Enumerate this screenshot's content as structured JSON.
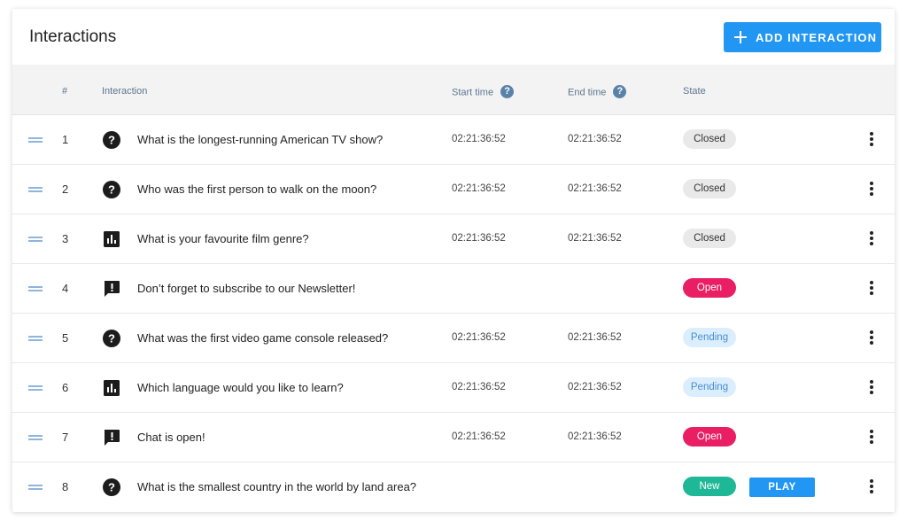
{
  "header": {
    "title": "Interactions",
    "add_button_label": "ADD INTERACTION"
  },
  "columns": {
    "num": "#",
    "interaction": "Interaction",
    "start_time": "Start time",
    "end_time": "End time",
    "state": "State",
    "help_glyph": "?"
  },
  "colors": {
    "accent": "#2196f3",
    "open": "#e91e63",
    "new": "#1fb896",
    "pending_bg": "#dbeefd"
  },
  "rows": [
    {
      "num": "1",
      "icon": "question-icon",
      "text": "What is the longest-running American TV show?",
      "start": "02:21:36:52",
      "end": "02:21:36:52",
      "state": "Closed",
      "state_kind": "closed"
    },
    {
      "num": "2",
      "icon": "question-icon",
      "text": "Who was the first person to walk on the moon?",
      "start": "02:21:36:52",
      "end": "02:21:36:52",
      "state": "Closed",
      "state_kind": "closed"
    },
    {
      "num": "3",
      "icon": "poll-icon",
      "text": "What is your favourite film genre?",
      "start": "02:21:36:52",
      "end": "02:21:36:52",
      "state": "Closed",
      "state_kind": "closed"
    },
    {
      "num": "4",
      "icon": "announcement-icon",
      "text": "Don’t forget to subscribe to our Newsletter!",
      "start": "",
      "end": "",
      "state": "Open",
      "state_kind": "open"
    },
    {
      "num": "5",
      "icon": "question-icon",
      "text": "What was the first video game console released?",
      "start": "02:21:36:52",
      "end": "02:21:36:52",
      "state": "Pending",
      "state_kind": "pending"
    },
    {
      "num": "6",
      "icon": "poll-icon",
      "text": "Which language would you like to learn?",
      "start": "02:21:36:52",
      "end": "02:21:36:52",
      "state": "Pending",
      "state_kind": "pending"
    },
    {
      "num": "7",
      "icon": "announcement-icon",
      "text": "Chat is open!",
      "start": "02:21:36:52",
      "end": "02:21:36:52",
      "state": "Open",
      "state_kind": "open"
    },
    {
      "num": "8",
      "icon": "question-icon",
      "text": "What is the smallest country in the world by land area?",
      "start": "",
      "end": "",
      "state": "New",
      "state_kind": "new",
      "action_label": "PLAY"
    }
  ]
}
